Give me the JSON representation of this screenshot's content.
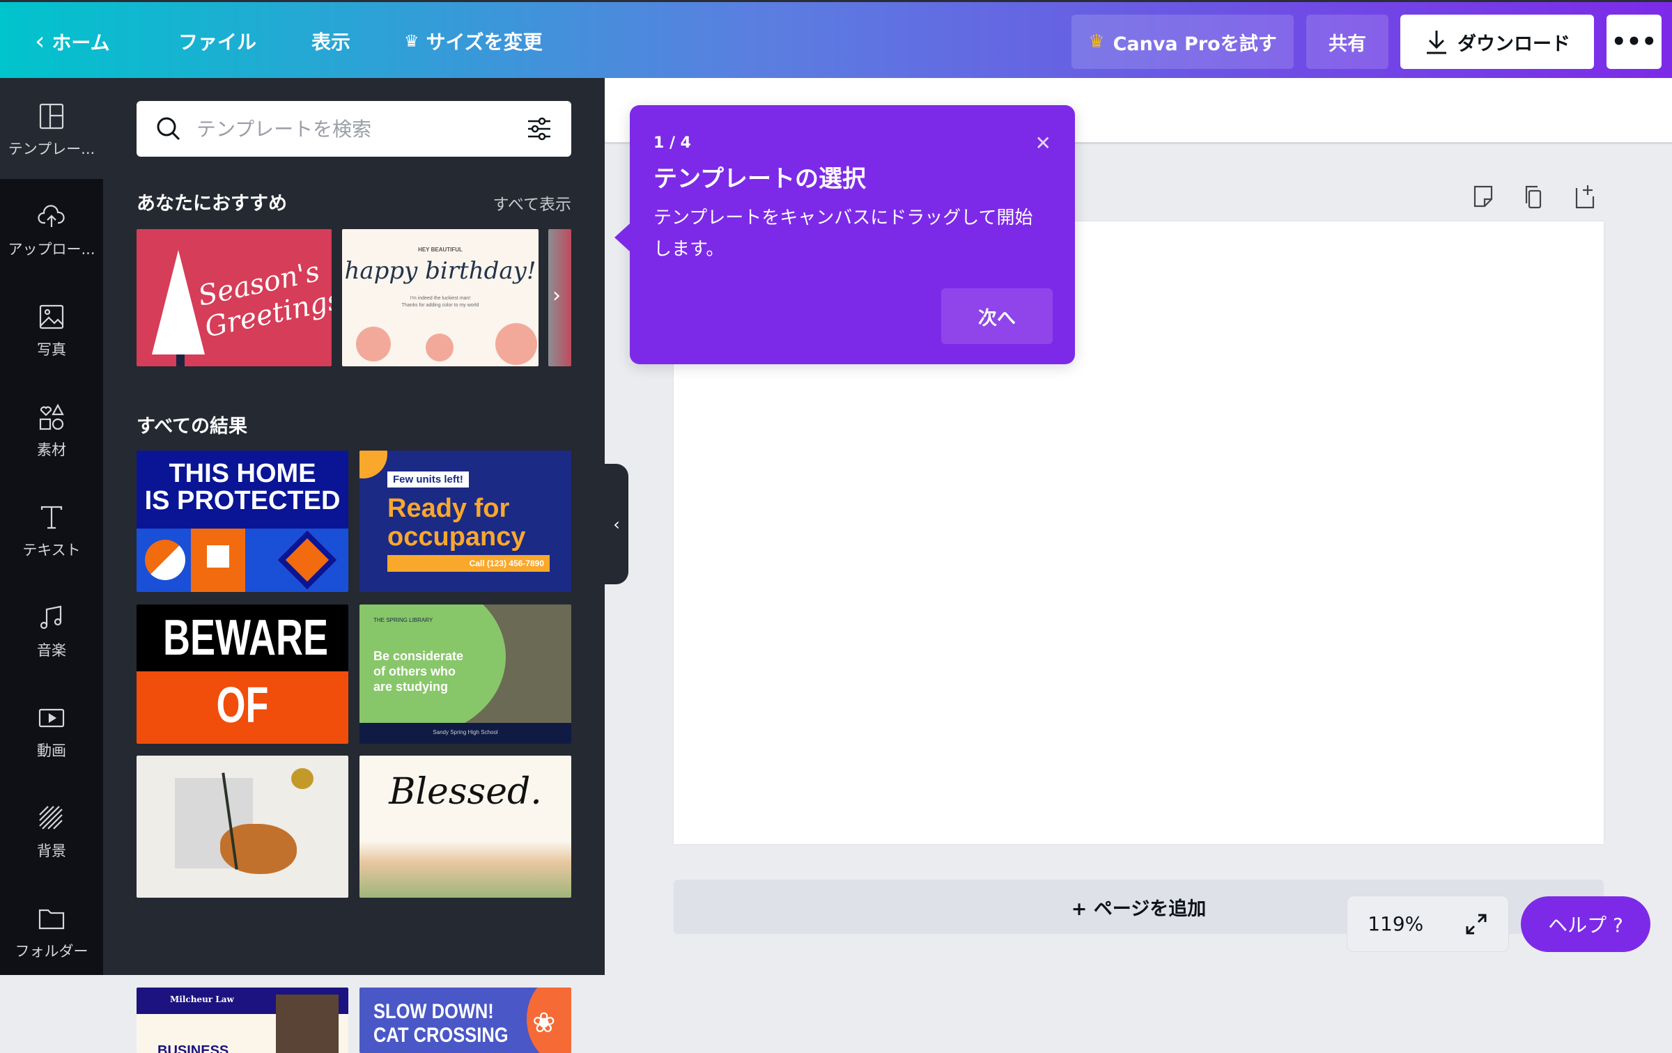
{
  "topbar": {
    "home": "ホーム",
    "file": "ファイル",
    "view": "表示",
    "resize": "サイズを変更",
    "try_pro": "Canva Proを試す",
    "share": "共有",
    "download": "ダウンロード",
    "more_icon": "ellipsis-icon",
    "crown_color": "#f5b81c"
  },
  "rail": {
    "items": [
      {
        "label": "テンプレー...",
        "icon": "template-icon"
      },
      {
        "label": "アップロー...",
        "icon": "cloud-upload-icon"
      },
      {
        "label": "写真",
        "icon": "photo-icon"
      },
      {
        "label": "素材",
        "icon": "elements-icon"
      },
      {
        "label": "テキスト",
        "icon": "text-icon"
      },
      {
        "label": "音楽",
        "icon": "music-icon"
      },
      {
        "label": "動画",
        "icon": "video-icon"
      },
      {
        "label": "背景",
        "icon": "background-icon"
      },
      {
        "label": "フォルダー",
        "icon": "folder-icon"
      }
    ]
  },
  "panel": {
    "search_placeholder": "テンプレートを検索",
    "recommended_title": "あなたにおすすめ",
    "see_all": "すべて表示",
    "recommended": [
      {
        "text": "Season's Greetings!"
      },
      {
        "top": "HEY BEAUTIFUL",
        "text": "happy birthday!",
        "sub1": "I'm indeed the luckiest man!",
        "sub2": "Thanks for adding color to my world"
      }
    ],
    "all_results_title": "すべての結果",
    "results": [
      {
        "line1": "THIS HOME",
        "line2": "IS PROTECTED"
      },
      {
        "badge": "Few units left!",
        "line1": "Ready for",
        "line2": "occupancy",
        "phone": "Call (123) 456-7890"
      },
      {
        "line1": "BEWARE",
        "line2": "OF DOGS"
      },
      {
        "top": "THE SPRING LIBRARY",
        "line1": "Be considerate",
        "line2": "of others who",
        "line3": "are studying",
        "footer": "Sandy Spring High School"
      },
      {},
      {
        "text": "Blessed."
      },
      {
        "top": "Milcheur Law",
        "line1": "BUSINESS"
      },
      {
        "line1": "SLOW DOWN!",
        "line2": "CAT CROSSING"
      }
    ]
  },
  "tooltip": {
    "step": "1 / 4",
    "title": "テンプレートの選択",
    "body": "テンプレートをキャンバスにドラッグして開始します。",
    "next": "次へ",
    "accent": "#7d2ae8"
  },
  "canvas": {
    "add_page": "+ ページを追加",
    "zoom": "119%",
    "help": "ヘルプ ?"
  }
}
